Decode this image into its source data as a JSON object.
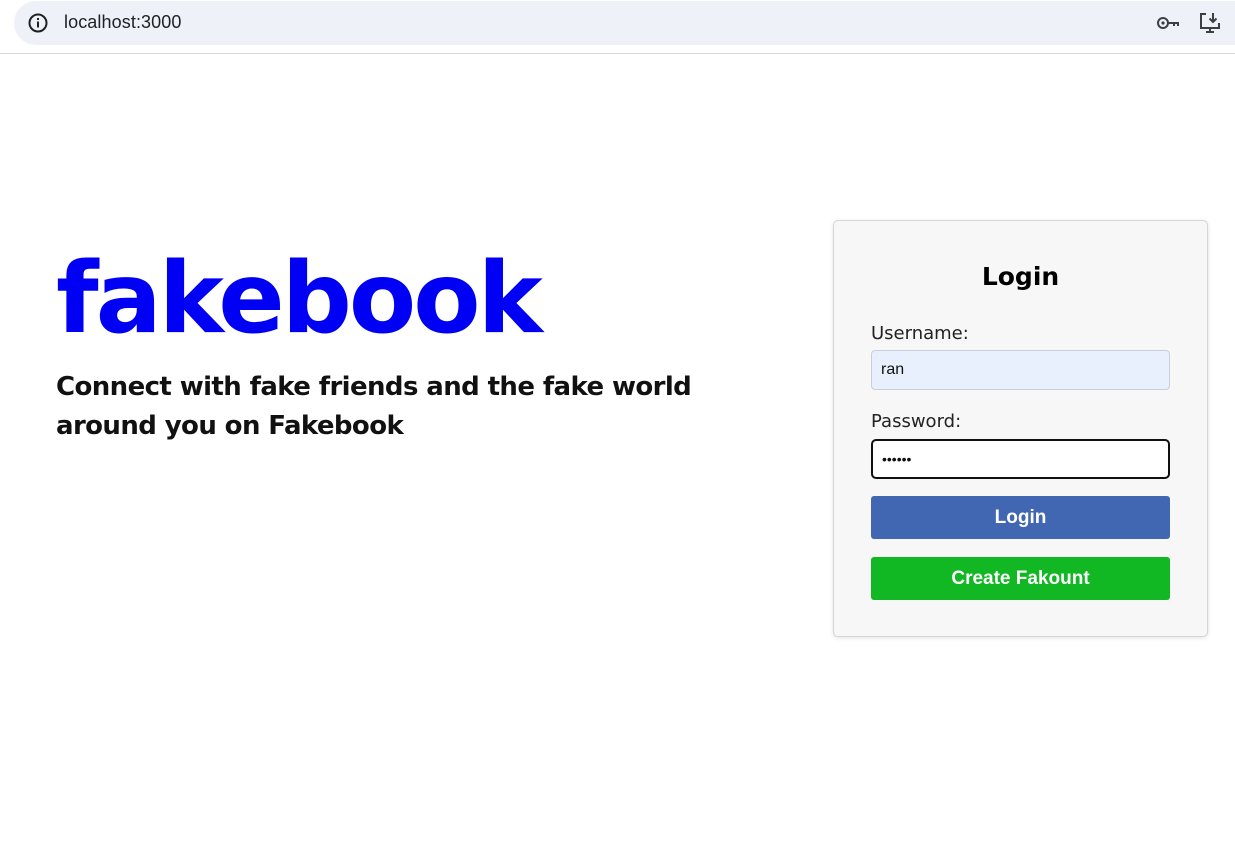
{
  "browser": {
    "url": "localhost:3000",
    "icons": {
      "site_info": "info-icon",
      "passwords": "key-icon",
      "install": "install-app-icon"
    }
  },
  "hero": {
    "brand": "fakebook",
    "brand_color": "#0000f5",
    "tagline": "Connect with fake friends and the fake world around you on Fakebook"
  },
  "login": {
    "title": "Login",
    "username_label": "Username:",
    "username_value": "ran",
    "password_label": "Password:",
    "password_value": "••••••",
    "login_button": "Login",
    "login_button_color": "#4267b2",
    "create_button": "Create Fakount",
    "create_button_color": "#12b824"
  }
}
